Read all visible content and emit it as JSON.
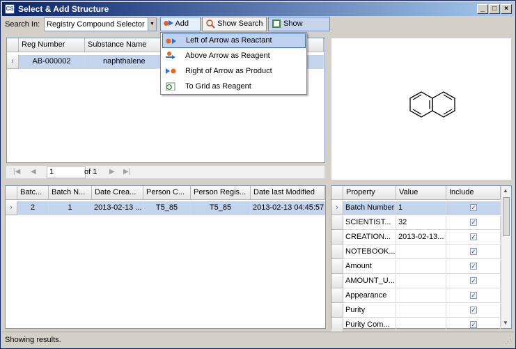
{
  "window": {
    "title": "Select & Add Structure",
    "app_icon_text": "CS",
    "controls": [
      "_",
      "□",
      "×"
    ]
  },
  "toolbar": {
    "search_label": "Search In:",
    "search_value": "Registry Compound Selector",
    "add_label": "Add",
    "show_search_label": "Show Search",
    "show_results_label": "Show Results"
  },
  "add_menu": {
    "items": [
      {
        "label": "Left of Arrow as Reactant",
        "icon": "arrow-reactant-icon"
      },
      {
        "label": "Above Arrow as Reagent",
        "icon": "arrow-reagent-icon"
      },
      {
        "label": "Right of Arrow as Product",
        "icon": "arrow-product-icon"
      },
      {
        "label": "To Grid as Reagent",
        "icon": "grid-reagent-icon"
      }
    ]
  },
  "compound_grid": {
    "columns": [
      "Reg Number",
      "Substance Name"
    ],
    "rows": [
      {
        "reg_number": "AB-000002",
        "substance_name": "naphthalene"
      }
    ]
  },
  "pager": {
    "page": "1",
    "of_label": "of 1"
  },
  "batch_grid": {
    "columns": [
      "Batc...",
      "Batch N...",
      "Date Crea...",
      "Person C...",
      "Person Regis...",
      "Date last Modified"
    ],
    "rows": [
      {
        "cells": [
          "2",
          "1",
          "2013-02-13 ...",
          "T5_85",
          "T5_85",
          "2013-02-13 04:45:57"
        ]
      }
    ]
  },
  "property_grid": {
    "columns": [
      "Property",
      "Value",
      "Include"
    ],
    "rows": [
      {
        "property": "Batch Number",
        "value": "1",
        "include": true
      },
      {
        "property": "SCIENTIST...",
        "value": "32",
        "include": true
      },
      {
        "property": "CREATION...",
        "value": "2013-02-13...",
        "include": true
      },
      {
        "property": "NOTEBOOK...",
        "value": "",
        "include": true
      },
      {
        "property": "Amount",
        "value": "",
        "include": true
      },
      {
        "property": "AMOUNT_U...",
        "value": "",
        "include": true
      },
      {
        "property": "Appearance",
        "value": "",
        "include": true
      },
      {
        "property": "Purity",
        "value": "",
        "include": true
      },
      {
        "property": "Purity Com...",
        "value": "",
        "include": true
      }
    ]
  },
  "status": {
    "text": "Showing results."
  }
}
